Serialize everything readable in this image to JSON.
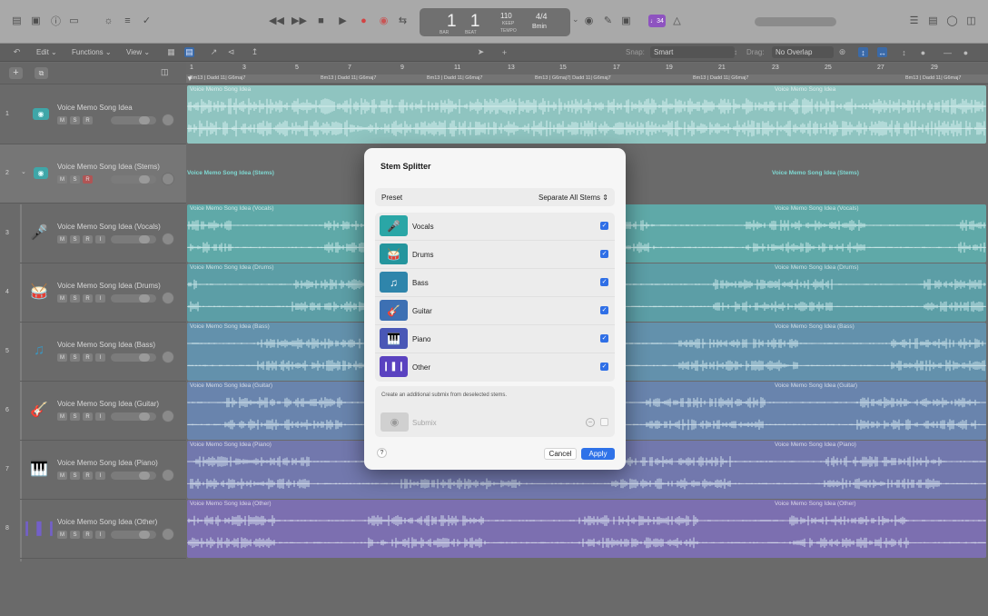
{
  "toolbar": {
    "left_icons": [
      "library-icon",
      "inspector-icon",
      "help-icon",
      "toolbar-toggle-icon",
      "smart-controls-icon",
      "mixer-icon",
      "editors-icon"
    ],
    "transport_icons": [
      "rewind-icon",
      "fast-forward-icon",
      "stop-icon",
      "play-icon",
      "record-icon",
      "capture-record-icon",
      "cycle-icon"
    ],
    "lcd": {
      "bar": "1",
      "beat": "1",
      "bar_label": "BAR",
      "beat_label": "BEAT",
      "tempo": "110",
      "tempo_label": "KEEP",
      "tempo_sub": "TEMPO",
      "signature": "4/4",
      "key": "Bmin"
    },
    "after_lcd_icons": [
      "tuner-icon",
      "pencil-icon",
      "count-in-icon"
    ],
    "badge": "♩34",
    "right_icons": [
      "list-editors-icon",
      "note-pad-icon",
      "loop-browser-icon",
      "browser-icon"
    ]
  },
  "subbar": {
    "edit": "Edit",
    "functions": "Functions",
    "view": "View",
    "snap_label": "Snap:",
    "snap_value": "Smart",
    "drag_label": "Drag:",
    "drag_value": "No Overlap"
  },
  "ruler": {
    "ticks": [
      "1",
      "3",
      "5",
      "7",
      "9",
      "11",
      "13",
      "15",
      "17",
      "19",
      "21",
      "23",
      "25",
      "27",
      "29"
    ],
    "chords": [
      "Bm13 | Dadd 11| G6maj7",
      "Bm13 | Dadd 11| G6maj7",
      "Bm13 | Dadd 11| G6maj7",
      "Bm13 | G6maj7| Dadd 11| G6maj7",
      "Bm13 | Dadd 11| G6maj7",
      "Bm13 | Dadd 11| G6maj7"
    ]
  },
  "tracks": [
    {
      "num": "1",
      "name": "Voice Memo Song Idea",
      "icon": "waveform-track-icon",
      "buttons": [
        "M",
        "S",
        "R"
      ]
    },
    {
      "num": "2",
      "name": "Voice Memo Song Idea (Stems)",
      "icon": "folder-stack-icon",
      "buttons": [
        "M",
        "S",
        "R"
      ]
    },
    {
      "num": "3",
      "name": "Voice Memo Song Idea (Vocals)",
      "icon": "microphone-icon",
      "buttons": [
        "M",
        "S",
        "R",
        "I"
      ]
    },
    {
      "num": "4",
      "name": "Voice Memo Song Idea (Drums)",
      "icon": "drum-kit-icon",
      "buttons": [
        "M",
        "S",
        "R",
        "I"
      ]
    },
    {
      "num": "5",
      "name": "Voice Memo Song Idea (Bass)",
      "icon": "bass-guitar-icon",
      "buttons": [
        "M",
        "S",
        "R",
        "I"
      ]
    },
    {
      "num": "6",
      "name": "Voice Memo Song Idea (Guitar)",
      "icon": "guitar-icon",
      "buttons": [
        "M",
        "S",
        "R",
        "I"
      ]
    },
    {
      "num": "7",
      "name": "Voice Memo Song Idea (Piano)",
      "icon": "piano-icon",
      "buttons": [
        "M",
        "S",
        "R",
        "I"
      ]
    },
    {
      "num": "8",
      "name": "Voice Memo Song Idea (Other)",
      "icon": "waveform-other-icon",
      "buttons": [
        "M",
        "S",
        "R",
        "I"
      ]
    }
  ],
  "regions": [
    {
      "label": "Voice Memo Song Idea",
      "color": "#8fc4c0"
    },
    {
      "label": "Voice Memo Song Idea (Stems)",
      "color": "#6a6a6a"
    },
    {
      "label": "Voice Memo Song Idea (Vocals)",
      "color": "#5fa9a8"
    },
    {
      "label": "Voice Memo Song Idea (Drums)",
      "color": "#5c9ea6"
    },
    {
      "label": "Voice Memo Song Idea (Bass)",
      "color": "#6391ac"
    },
    {
      "label": "Voice Memo Song Idea (Guitar)",
      "color": "#6984ad"
    },
    {
      "label": "Voice Memo Song Idea (Piano)",
      "color": "#7278ad"
    },
    {
      "label": "Voice Memo Song Idea (Other)",
      "color": "#7c6fb0"
    }
  ],
  "dialog": {
    "title": "Stem Splitter",
    "preset_label": "Preset",
    "preset_value": "Separate All Stems",
    "stems": [
      {
        "label": "Vocals",
        "icon": "microphone-icon",
        "color": "#2aa6a6",
        "checked": true
      },
      {
        "label": "Drums",
        "icon": "drum-kit-icon",
        "color": "#24959d",
        "checked": true
      },
      {
        "label": "Bass",
        "icon": "bass-guitar-icon",
        "color": "#2f85ab",
        "checked": true
      },
      {
        "label": "Guitar",
        "icon": "guitar-icon",
        "color": "#3d70b3",
        "checked": true
      },
      {
        "label": "Piano",
        "icon": "piano-icon",
        "color": "#4957b6",
        "checked": true
      },
      {
        "label": "Other",
        "icon": "waveform-other-icon",
        "color": "#5a42c0",
        "checked": true
      }
    ],
    "submix_note": "Create an additional submix from deselected stems.",
    "submix_label": "Submix",
    "help": "?",
    "cancel": "Cancel",
    "apply": "Apply"
  }
}
